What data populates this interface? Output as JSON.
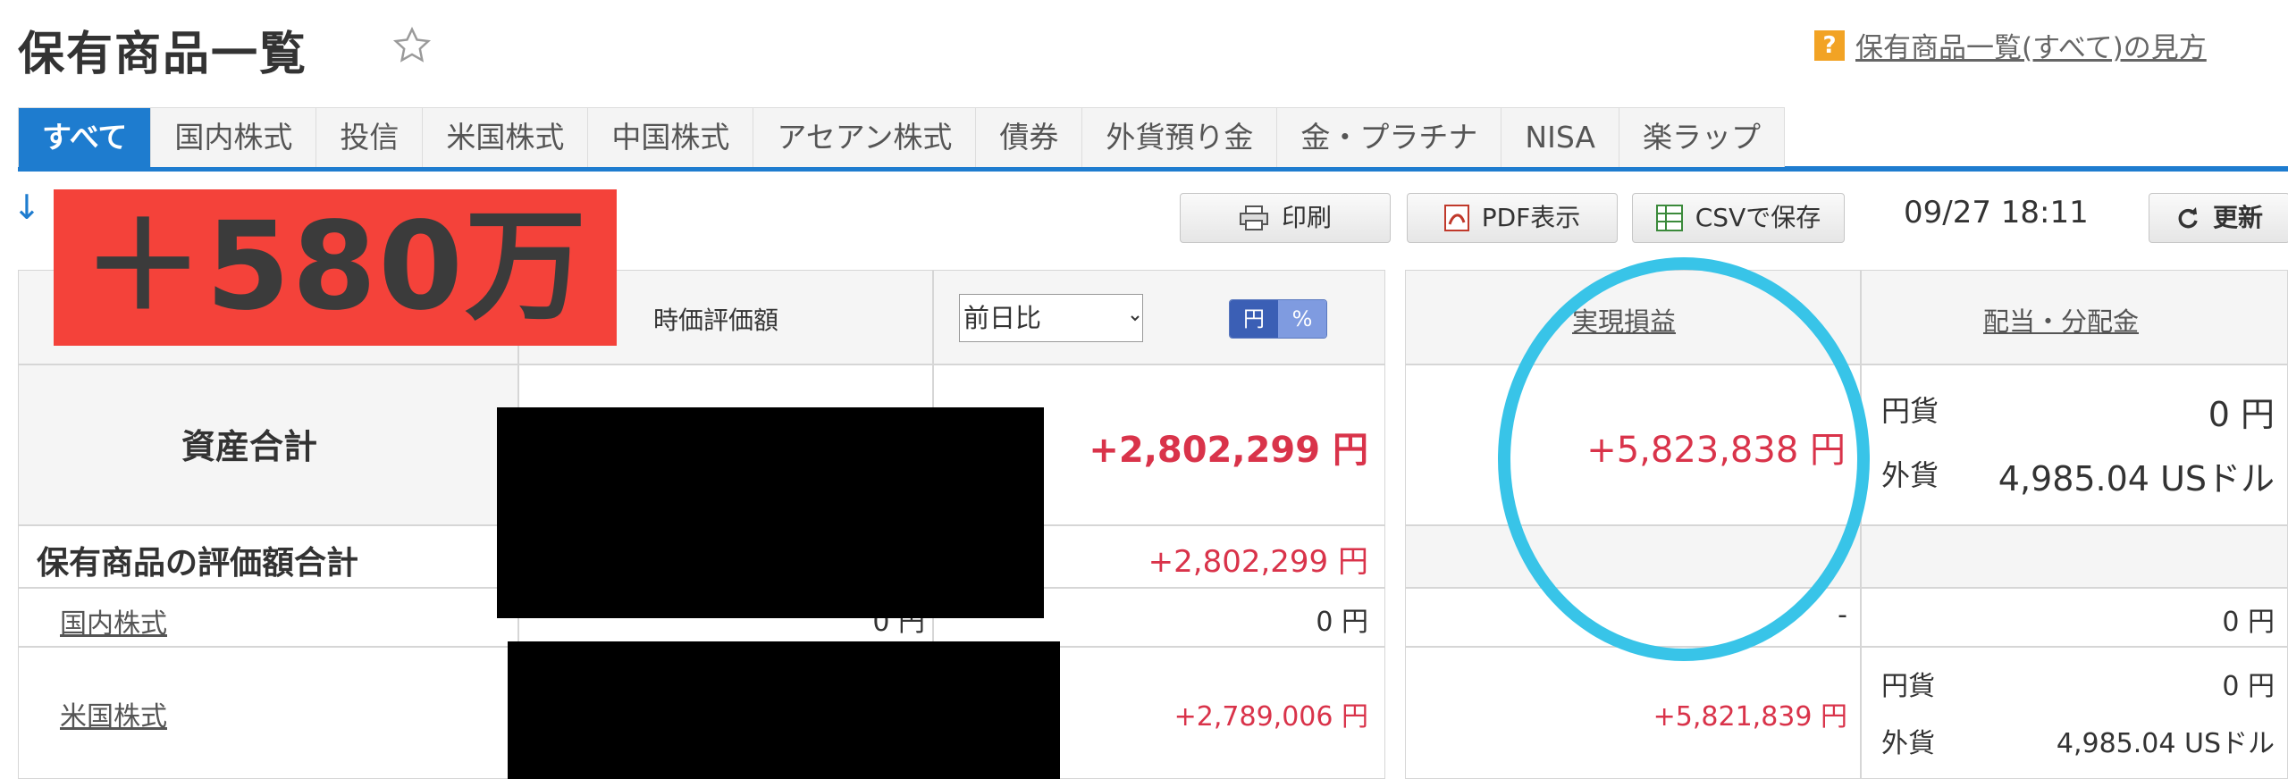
{
  "header": {
    "title": "保有商品一覧",
    "help_icon_text": "?",
    "help_link": "保有商品一覧(すべて)の見方"
  },
  "tabs": [
    {
      "label": "すべて",
      "active": true
    },
    {
      "label": "国内株式"
    },
    {
      "label": "投信"
    },
    {
      "label": "米国株式"
    },
    {
      "label": "中国株式"
    },
    {
      "label": "アセアン株式"
    },
    {
      "label": "債券"
    },
    {
      "label": "外貨預り金"
    },
    {
      "label": "金・プラチナ"
    },
    {
      "label": "NISA"
    },
    {
      "label": "楽ラップ"
    }
  ],
  "toolbar": {
    "down_arrow": "↓",
    "print_label": "印刷",
    "pdf_label": "PDF表示",
    "csv_label": "CSVで保存",
    "timestamp": "09/27 18:11",
    "refresh_label": "更新"
  },
  "overlay": {
    "badge_text": "＋580万"
  },
  "table": {
    "headers": {
      "market_value": "時価評価額",
      "day_change_select": "前日比",
      "unit_yen": "円",
      "unit_pct": "%",
      "realized_pl": "実現損益",
      "dividends": "配当・分配金"
    },
    "total_row": {
      "label": "資産合計",
      "day_change": "+2,802,299 円",
      "realized_pl": "+5,823,838 円",
      "div_jpy_label": "円貨",
      "div_jpy_value": "0 円",
      "div_fx_label": "外貨",
      "div_fx_value": "4,985.04 USドル"
    },
    "holdings_total_row": {
      "label": "保有商品の評価額合計",
      "day_change": "+2,802,299 円"
    },
    "domestic_row": {
      "label": "国内株式",
      "market_value_partial": "0 円",
      "day_change": "0 円",
      "realized_pl": "-",
      "dividends": "0 円"
    },
    "us_row": {
      "label": "米国株式",
      "day_change": "+2,789,006 円",
      "realized_pl": "+5,821,839 円",
      "div_jpy_label": "円貨",
      "div_jpy_value": "0 円",
      "div_fx_label": "外貨",
      "div_fx_value": "4,985.04 USドル"
    }
  },
  "colors": {
    "accent": "#1e7ccf",
    "positive": "#d9334a",
    "badge": "#f4423a",
    "circle": "#38c4e8"
  }
}
